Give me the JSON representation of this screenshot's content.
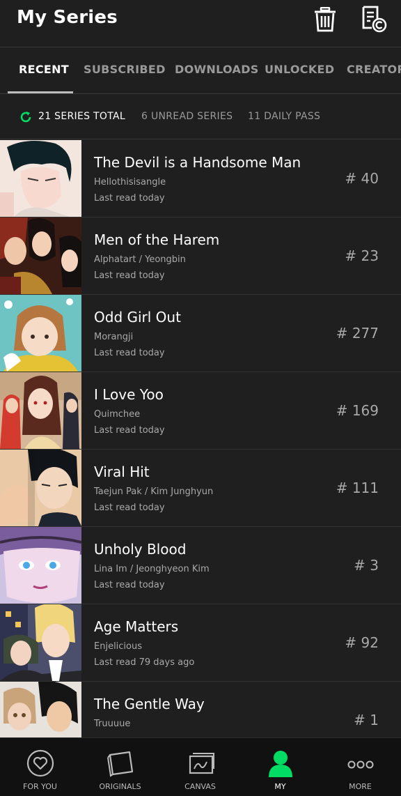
{
  "header": {
    "title": "My Series"
  },
  "icons": {
    "delete": "trash-icon",
    "copyright_doc": "document-copyright-icon"
  },
  "colors": {
    "accent": "#00dc64",
    "background": "#1f1f1f",
    "nav_background": "#111111"
  },
  "tabs": [
    {
      "label": "RECENT",
      "active": true
    },
    {
      "label": "SUBSCRIBED",
      "active": false
    },
    {
      "label": "DOWNLOADS",
      "active": false
    },
    {
      "label": "UNLOCKED",
      "active": false
    },
    {
      "label": "CREATORS",
      "active": false
    }
  ],
  "summary": {
    "total": "21 SERIES TOTAL",
    "unread": "6  UNREAD SERIES",
    "daily_pass": "11  DAILY PASS"
  },
  "series": [
    {
      "title": "The Devil is a Handsome Man",
      "author": "Hellothisisangle",
      "last_read": "Last read today",
      "episode": "# 40"
    },
    {
      "title": "Men of the Harem",
      "author": "Alphatart / Yeongbin",
      "last_read": "Last read today",
      "episode": "# 23"
    },
    {
      "title": "Odd Girl Out",
      "author": "Morangji",
      "last_read": "Last read today",
      "episode": "# 277"
    },
    {
      "title": "I Love Yoo",
      "author": "Quimchee",
      "last_read": "Last read today",
      "episode": "# 169"
    },
    {
      "title": "Viral Hit",
      "author": "Taejun Pak / Kim Junghyun",
      "last_read": "Last read today",
      "episode": "# 111"
    },
    {
      "title": "Unholy Blood",
      "author": "Lina Im / Jeonghyeon Kim",
      "last_read": "Last read today",
      "episode": "# 3"
    },
    {
      "title": "Age Matters",
      "author": "Enjelicious",
      "last_read": "Last read 79 days ago",
      "episode": "# 92"
    },
    {
      "title": "The Gentle Way",
      "author": "Truuuue",
      "last_read": "",
      "episode": "# 1"
    }
  ],
  "bottom_nav": [
    {
      "label": "FOR YOU",
      "icon": "heart-icon",
      "active": false
    },
    {
      "label": "ORIGINALS",
      "icon": "originals-icon",
      "active": false
    },
    {
      "label": "CANVAS",
      "icon": "canvas-icon",
      "active": false
    },
    {
      "label": "MY",
      "icon": "person-icon",
      "active": true
    },
    {
      "label": "MORE",
      "icon": "more-icon",
      "active": false
    }
  ]
}
